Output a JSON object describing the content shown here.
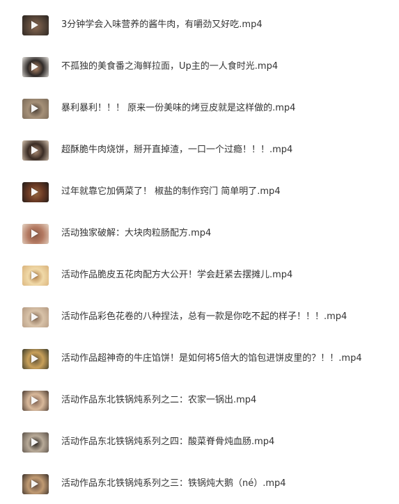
{
  "files": [
    {
      "name": "3分钟学会入味营养的酱牛肉，有嚼劲又好吃.mp4",
      "thumbnail": {
        "icon": "video-thumbnail-icon",
        "colors": [
          "#2a2420",
          "#5d4a3c",
          "#8c6a52"
        ]
      }
    },
    {
      "name": "不孤独的美食番之海鲜拉面，Up主的一人食时光.mp4",
      "thumbnail": {
        "icon": "video-thumbnail-icon",
        "colors": [
          "#e9e6e1",
          "#2f2a28",
          "#b88a6a"
        ]
      }
    },
    {
      "name": "暴利暴利！！！ 原来一份美味的烤豆皮就是这样做的.mp4",
      "thumbnail": {
        "icon": "video-thumbnail-icon",
        "colors": [
          "#7a6a58",
          "#a59078",
          "#4f4338"
        ]
      }
    },
    {
      "name": "超酥脆牛肉烧饼，掰开直掉渣，一口一个过瘾！！！.mp4",
      "thumbnail": {
        "icon": "video-thumbnail-icon",
        "colors": [
          "#d8c6b2",
          "#3a2c24",
          "#b09078"
        ]
      }
    },
    {
      "name": "过年就靠它加俩菜了！ 椒盐的制作窍门 简单明了.mp4",
      "thumbnail": {
        "icon": "video-thumbnail-icon",
        "colors": [
          "#1f1b19",
          "#6b3a24",
          "#9c6b42"
        ]
      }
    },
    {
      "name": "活动独家破解：大块肉粒肠配方.mp4",
      "thumbnail": {
        "icon": "video-thumbnail-icon",
        "colors": [
          "#e6d6c6",
          "#b47a62",
          "#8c5a46"
        ]
      }
    },
    {
      "name": "活动作品脆皮五花肉配方大公开！学会赶紧去摆摊儿.mp4",
      "thumbnail": {
        "icon": "video-thumbnail-icon",
        "colors": [
          "#d9b27a",
          "#f0d9a8",
          "#b8864e"
        ]
      }
    },
    {
      "name": "活动作品彩色花卷的八种捏法，总有一款是你吃不起的样子！！！.mp4",
      "thumbnail": {
        "icon": "video-thumbnail-icon",
        "colors": [
          "#b49a82",
          "#d8c2a8",
          "#8c7058"
        ]
      }
    },
    {
      "name": "活动作品超神奇的牛庄馅饼！是如何将5倍大的馅包进饼皮里的？！！.mp4",
      "thumbnail": {
        "icon": "video-thumbnail-icon",
        "colors": [
          "#3a3a2a",
          "#c8a05a",
          "#6a5a3a"
        ]
      }
    },
    {
      "name": "活动作品东北铁锅炖系列之二：农家一锅出.mp4",
      "thumbnail": {
        "icon": "video-thumbnail-icon",
        "colors": [
          "#4a3a30",
          "#d8b89a",
          "#8a6a58"
        ]
      }
    },
    {
      "name": "活动作品东北铁锅炖系列之四：酸菜脊骨炖血肠.mp4",
      "thumbnail": {
        "icon": "video-thumbnail-icon",
        "colors": [
          "#5a5048",
          "#b8aa98",
          "#2e2822"
        ]
      }
    },
    {
      "name": "活动作品东北铁锅炖系列之三：铁锅炖大鹅（né）.mp4",
      "thumbnail": {
        "icon": "video-thumbnail-icon",
        "colors": [
          "#3a302a",
          "#c09a72",
          "#6a5244"
        ]
      }
    }
  ]
}
